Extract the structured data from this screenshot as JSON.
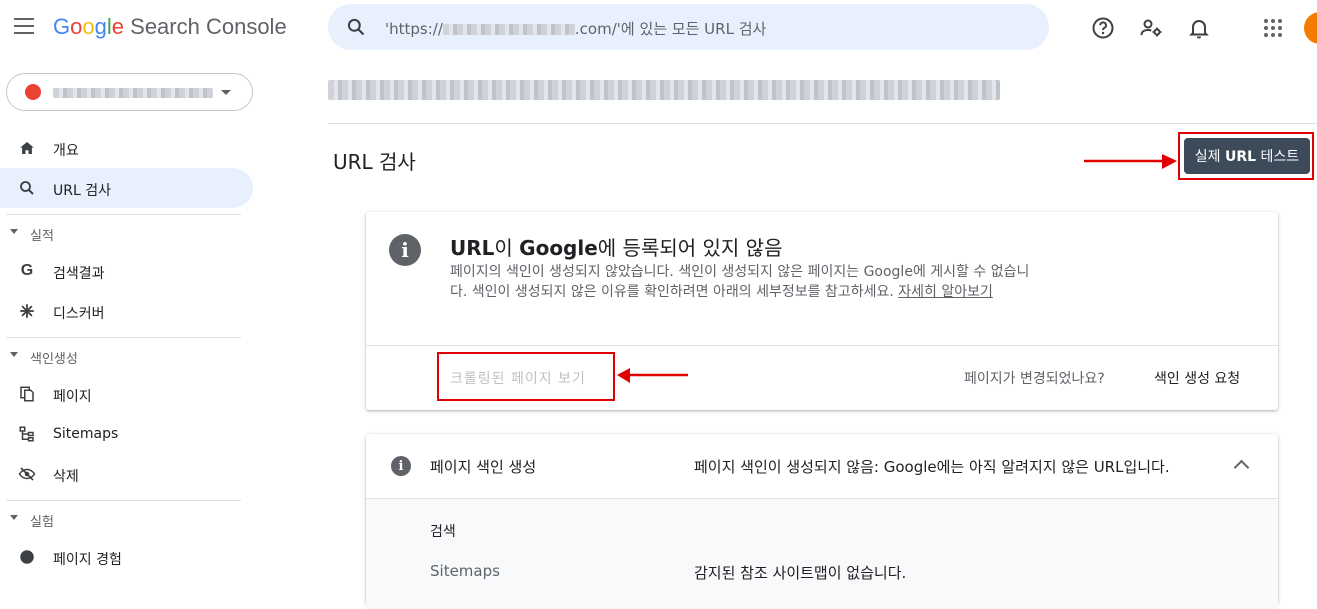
{
  "app": {
    "logo_google": [
      "G",
      "o",
      "o",
      "g",
      "l",
      "e"
    ],
    "logo_product": "Search Console"
  },
  "search": {
    "text_prefix": "'https://",
    "text_suffix": ".com/'에 있는 모든 URL 검사"
  },
  "top_icons": [
    "help-icon",
    "manage-users-icon",
    "notifications-icon",
    "apps-icon"
  ],
  "sidebar": {
    "items": [
      {
        "label": "개요",
        "icon": "home-icon"
      },
      {
        "label": "URL 검사",
        "icon": "search-icon",
        "active": true
      }
    ],
    "sections": [
      {
        "label": "실적",
        "items": [
          {
            "label": "검색결과",
            "icon": "google-g-icon"
          },
          {
            "label": "디스커버",
            "icon": "asterisk-icon"
          }
        ]
      },
      {
        "label": "색인생성",
        "items": [
          {
            "label": "페이지",
            "icon": "pages-icon"
          },
          {
            "label": "Sitemaps",
            "icon": "sitemap-icon"
          },
          {
            "label": "삭제",
            "icon": "removals-icon"
          }
        ]
      },
      {
        "label": "실험",
        "items": [
          {
            "label": "페이지 경험",
            "icon": "experience-icon"
          }
        ]
      }
    ]
  },
  "main": {
    "title": "URL 검사",
    "live_test_button": {
      "prefix": "실제 ",
      "bold": "URL",
      "suffix": " 테스트"
    },
    "status": {
      "title_part1": "URL",
      "title_part2": "이 ",
      "title_part3": "Google",
      "title_part4": "에 등록되어 있지 않음",
      "description": "페이지의 색인이 생성되지 않았습니다. 색인이 생성되지 않은 페이지는 Google에 게시할 수 없습니다. 색인이 생성되지 않은 이유를 확인하려면 아래의 세부정보를 참고하세요. ",
      "learn_more": "자세히 알아보기",
      "view_crawled": "크롤링된 페이지 보기",
      "changed_question": "페이지가 변경되었나요?",
      "request_indexing": "색인 생성 요청"
    },
    "coverage": {
      "label": "페이지 색인 생성",
      "value": "페이지 색인이 생성되지 않음: Google에는 아직 알려지지 않은 URL입니다.",
      "sub_heading": "검색",
      "rows": [
        {
          "key": "Sitemaps",
          "value": "감지된 참조 사이트맵이 없습니다."
        }
      ]
    }
  },
  "colors": {
    "accent": "#1a73e8",
    "annotation_red": "#e00000",
    "button_dark": "#3c4a5a"
  }
}
